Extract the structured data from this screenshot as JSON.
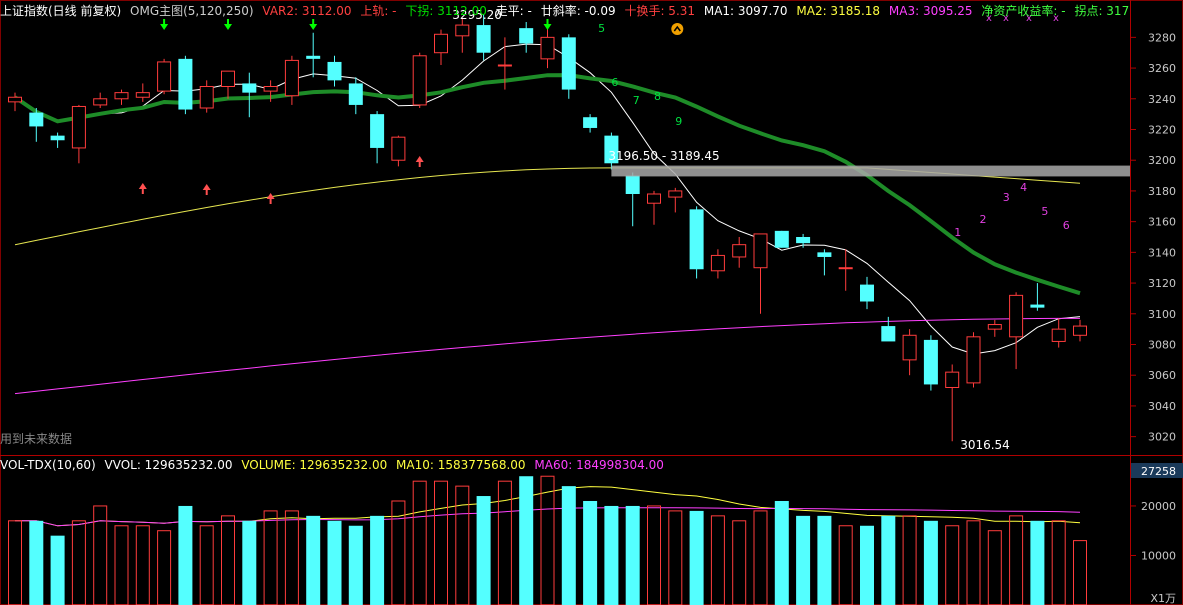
{
  "header": {
    "title": "上证指数(日线 前复权)",
    "indicator": "OMG主图(5,120,250)",
    "var2": "VAR2: 3112.00",
    "up_track": "上轨: -",
    "down_break": "下拐: 3112.00",
    "trend": "走平: -",
    "slope": "廿斜率: -0.09",
    "turnover": "十换手: 5.31",
    "ma1": "MA1: 3097.70",
    "ma2": "MA2: 3185.18",
    "ma3": "MA3: 3095.25",
    "roe": "净资产收益率: -",
    "inflection": "拐点: 317",
    "future_note": "用到未来数据"
  },
  "vol_header": {
    "name": "VOL-TDX(10,60)",
    "vvol": "VVOL: 129635232.00",
    "volume": "VOLUME: 129635232.00",
    "ma10": "MA10: 158377568.00",
    "ma60": "MA60: 184998304.00"
  },
  "colors": {
    "up": "#ff3c3c",
    "down": "#54ffff",
    "ma1": "#ffffff",
    "ma2": "#1e8c28",
    "ma3": "#ff40ff",
    "long": "#e6e650",
    "label": "#ff5050",
    "green_label": "#00ff40"
  },
  "chart_data": {
    "type": "candlestick",
    "price_axis": {
      "min": 3010,
      "max": 3290,
      "ticks": [
        3280,
        3260,
        3240,
        3220,
        3200,
        3180,
        3160,
        3140,
        3120,
        3100,
        3080,
        3060,
        3040,
        3020
      ]
    },
    "volume_axis": {
      "ticks": [
        "27258",
        "20000",
        "10000"
      ],
      "unit": "X1万"
    },
    "candles": [
      {
        "o": 3238,
        "h": 3244,
        "l": 3232,
        "c": 3241
      },
      {
        "o": 3231,
        "h": 3234,
        "l": 3212,
        "c": 3222
      },
      {
        "o": 3216,
        "h": 3218,
        "l": 3208,
        "c": 3213
      },
      {
        "o": 3208,
        "h": 3236,
        "l": 3198,
        "c": 3235
      },
      {
        "o": 3236,
        "h": 3244,
        "l": 3234,
        "c": 3240
      },
      {
        "o": 3240,
        "h": 3246,
        "l": 3236,
        "c": 3244
      },
      {
        "o": 3241,
        "h": 3250,
        "l": 3238,
        "c": 3244
      },
      {
        "o": 3245,
        "h": 3266,
        "l": 3243,
        "c": 3264
      },
      {
        "o": 3266,
        "h": 3268,
        "l": 3230,
        "c": 3233
      },
      {
        "o": 3234,
        "h": 3252,
        "l": 3231,
        "c": 3248
      },
      {
        "o": 3248,
        "h": 3254,
        "l": 3240,
        "c": 3258
      },
      {
        "o": 3250,
        "h": 3257,
        "l": 3228,
        "c": 3244
      },
      {
        "o": 3245,
        "h": 3252,
        "l": 3238,
        "c": 3248
      },
      {
        "o": 3242,
        "h": 3268,
        "l": 3236,
        "c": 3265
      },
      {
        "o": 3268,
        "h": 3283,
        "l": 3254,
        "c": 3266
      },
      {
        "o": 3264,
        "h": 3268,
        "l": 3248,
        "c": 3252
      },
      {
        "o": 3250,
        "h": 3254,
        "l": 3230,
        "c": 3236
      },
      {
        "o": 3230,
        "h": 3232,
        "l": 3198,
        "c": 3208
      },
      {
        "o": 3200,
        "h": 3216,
        "l": 3196,
        "c": 3215
      },
      {
        "o": 3236,
        "h": 3270,
        "l": 3234,
        "c": 3268
      },
      {
        "o": 3270,
        "h": 3285,
        "l": 3262,
        "c": 3282
      },
      {
        "o": 3281,
        "h": 3292,
        "l": 3270,
        "c": 3288
      },
      {
        "o": 3288,
        "h": 3295,
        "l": 3265,
        "c": 3270
      },
      {
        "o": 3262,
        "h": 3280,
        "l": 3246,
        "c": 3262
      },
      {
        "o": 3286,
        "h": 3290,
        "l": 3270,
        "c": 3276
      },
      {
        "o": 3266,
        "h": 3286,
        "l": 3260,
        "c": 3280
      },
      {
        "o": 3280,
        "h": 3282,
        "l": 3240,
        "c": 3246
      },
      {
        "o": 3228,
        "h": 3230,
        "l": 3218,
        "c": 3221
      },
      {
        "o": 3216,
        "h": 3218,
        "l": 3194,
        "c": 3198
      },
      {
        "o": 3190,
        "h": 3192,
        "l": 3157,
        "c": 3178
      },
      {
        "o": 3172,
        "h": 3180,
        "l": 3158,
        "c": 3178
      },
      {
        "o": 3176,
        "h": 3182,
        "l": 3166,
        "c": 3180
      },
      {
        "o": 3168,
        "h": 3170,
        "l": 3123,
        "c": 3129
      },
      {
        "o": 3128,
        "h": 3142,
        "l": 3123,
        "c": 3138
      },
      {
        "o": 3137,
        "h": 3150,
        "l": 3130,
        "c": 3145
      },
      {
        "o": 3130,
        "h": 3152,
        "l": 3100,
        "c": 3152
      },
      {
        "o": 3154,
        "h": 3154,
        "l": 3143,
        "c": 3143
      },
      {
        "o": 3150,
        "h": 3152,
        "l": 3143,
        "c": 3146
      },
      {
        "o": 3140,
        "h": 3142,
        "l": 3125,
        "c": 3137
      },
      {
        "o": 3130,
        "h": 3142,
        "l": 3115,
        "c": 3130
      },
      {
        "o": 3119,
        "h": 3124,
        "l": 3103,
        "c": 3108
      },
      {
        "o": 3092,
        "h": 3098,
        "l": 3083,
        "c": 3082
      },
      {
        "o": 3070,
        "h": 3090,
        "l": 3060,
        "c": 3086
      },
      {
        "o": 3083,
        "h": 3086,
        "l": 3050,
        "c": 3054
      },
      {
        "o": 3052,
        "h": 3067,
        "l": 3017,
        "c": 3062
      },
      {
        "o": 3055,
        "h": 3088,
        "l": 3052,
        "c": 3085
      },
      {
        "o": 3090,
        "h": 3096,
        "l": 3085,
        "c": 3093
      },
      {
        "o": 3085,
        "h": 3114,
        "l": 3064,
        "c": 3112
      },
      {
        "o": 3106,
        "h": 3120,
        "l": 3102,
        "c": 3104
      },
      {
        "o": 3082,
        "h": 3097,
        "l": 3078,
        "c": 3090
      },
      {
        "o": 3086,
        "h": 3096,
        "l": 3082,
        "c": 3092
      }
    ],
    "volumes": [
      17,
      17,
      14,
      17,
      20,
      16,
      16,
      15,
      20,
      16,
      18,
      17,
      19,
      19,
      18,
      17,
      16,
      18,
      21,
      25,
      25,
      24,
      22,
      25,
      26,
      26,
      24,
      21,
      20,
      20,
      20,
      19,
      19,
      18,
      17,
      19,
      21,
      18,
      18,
      16,
      16,
      18,
      18,
      17,
      16,
      17,
      15,
      18,
      17,
      17,
      13
    ],
    "price_labels": [
      "3295.20",
      "3196.50 - 3189.45",
      "3016.54"
    ],
    "green_numbers": [
      "5",
      "6",
      "7",
      "8",
      "9"
    ],
    "magenta_numbers": [
      "1",
      "2",
      "3",
      "4",
      "5",
      "6"
    ]
  }
}
